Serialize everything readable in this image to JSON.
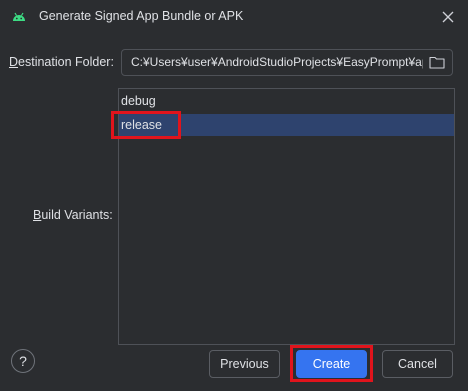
{
  "window": {
    "title": "Generate Signed App Bundle or APK"
  },
  "destination": {
    "label_mnemonic": "D",
    "label_rest": "estination Folder:",
    "value": "C:¥Users¥user¥AndroidStudioProjects¥EasyPrompt¥app"
  },
  "build_variants": {
    "label_mnemonic": "B",
    "label_rest": "uild Variants:",
    "items": [
      {
        "label": "debug",
        "selected": false
      },
      {
        "label": "release",
        "selected": true
      }
    ]
  },
  "footer": {
    "help_label": "?",
    "previous_label": "Previous",
    "create_label": "Create",
    "cancel_label": "Cancel"
  },
  "colors": {
    "background": "#2b2d30",
    "selection": "#2e436e",
    "primary_button": "#3574f0",
    "annotation_highlight": "#e0141c",
    "android_green": "#3ddc84"
  },
  "icons": {
    "app": "android-icon",
    "close": "close-icon",
    "browse": "folder-icon"
  }
}
